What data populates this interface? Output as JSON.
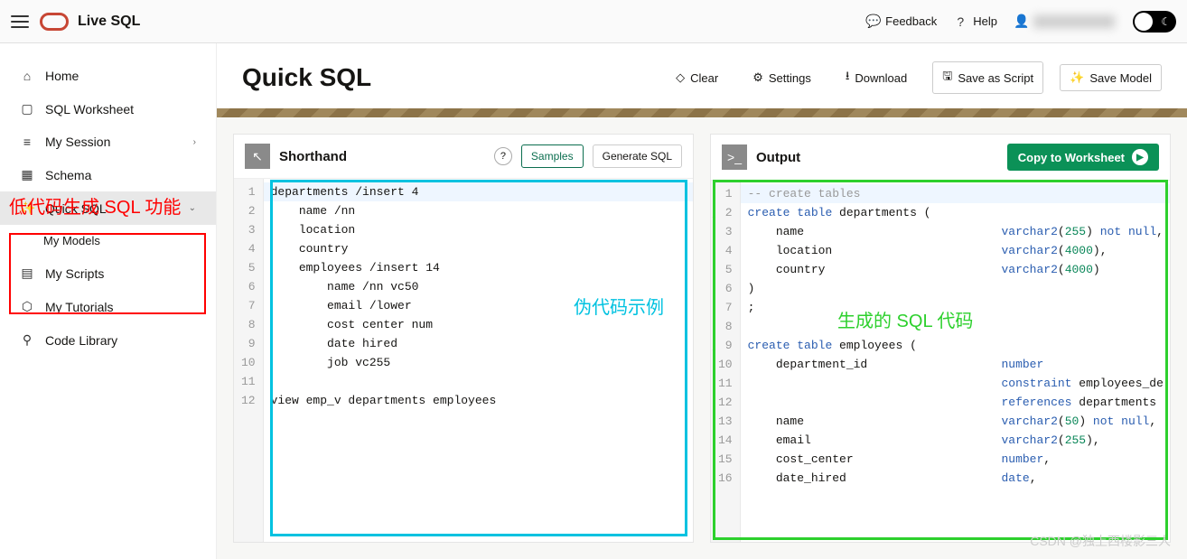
{
  "top": {
    "app_title": "Live SQL",
    "feedback": "Feedback",
    "help": "Help"
  },
  "sidebar": {
    "items": [
      {
        "icon": "⌂",
        "label": "Home"
      },
      {
        "icon": "▢",
        "label": "SQL Worksheet"
      },
      {
        "icon": "≡",
        "label": "My Session",
        "expandable": true
      },
      {
        "icon": "▦",
        "label": "Schema"
      },
      {
        "icon": "✨",
        "label": "Quick SQL",
        "active": true,
        "expandable": true
      },
      {
        "icon": "▤",
        "label": "My Scripts"
      },
      {
        "icon": "⬡",
        "label": "My Tutorials"
      },
      {
        "icon": "⚲",
        "label": "Code Library"
      }
    ],
    "quick_sql_sub": "My Models"
  },
  "page": {
    "title": "Quick SQL",
    "buttons": {
      "clear": "Clear",
      "settings": "Settings",
      "download": "Download",
      "save_script": "Save as Script",
      "save_model": "Save Model"
    }
  },
  "shorthand": {
    "title": "Shorthand",
    "samples": "Samples",
    "generate": "Generate SQL",
    "lines": [
      "departments /insert 4",
      "    name /nn",
      "    location",
      "    country",
      "    employees /insert 14",
      "        name /nn vc50",
      "        email /lower",
      "        cost center num",
      "        date hired",
      "        job vc255",
      "",
      "view emp_v departments employees"
    ]
  },
  "output": {
    "title": "Output",
    "copy": "Copy to Worksheet",
    "lines": [
      {
        "t": "cmt",
        "text": "-- create tables"
      },
      {
        "t": "sql",
        "text": "create table departments ("
      },
      {
        "t": "col",
        "name": "name",
        "type": "varchar2(255) not null,"
      },
      {
        "t": "col",
        "name": "location",
        "type": "varchar2(4000),"
      },
      {
        "t": "col",
        "name": "country",
        "type": "varchar2(4000)"
      },
      {
        "t": "raw",
        "text": ")"
      },
      {
        "t": "raw",
        "text": ";"
      },
      {
        "t": "raw",
        "text": ""
      },
      {
        "t": "sql",
        "text": "create table employees ("
      },
      {
        "t": "col",
        "name": "department_id",
        "type": "number"
      },
      {
        "t": "con",
        "text": "constraint employees_de"
      },
      {
        "t": "con",
        "text": "references departments"
      },
      {
        "t": "col",
        "name": "name",
        "type": "varchar2(50) not null,"
      },
      {
        "t": "col",
        "name": "email",
        "type": "varchar2(255),"
      },
      {
        "t": "col",
        "name": "cost_center",
        "type": "number,"
      },
      {
        "t": "col",
        "name": "date_hired",
        "type": "date,"
      }
    ]
  },
  "annot": {
    "red": "低代码生成 SQL 功能",
    "cyan": "伪代码示例",
    "green": "生成的 SQL 代码",
    "watermark": "CSDN @独上西楼影三人"
  }
}
